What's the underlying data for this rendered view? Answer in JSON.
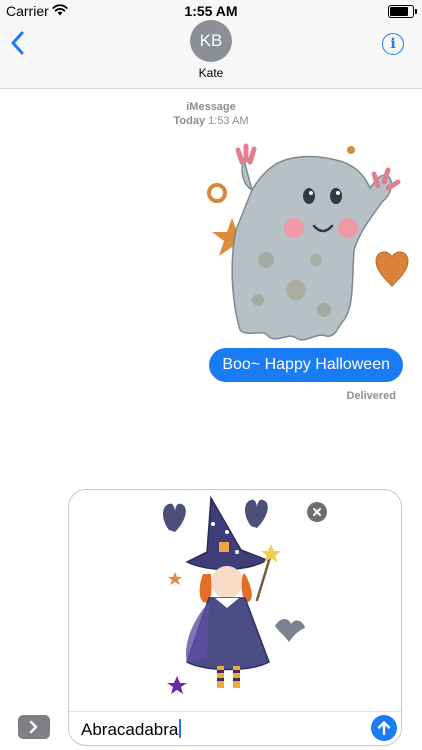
{
  "status_bar": {
    "carrier": "Carrier",
    "time": "1:55 AM",
    "battery_level": 0.9
  },
  "header": {
    "avatar_initials": "KB",
    "contact_name": "Kate",
    "info_glyph": "i"
  },
  "conversation": {
    "service": "iMessage",
    "timestamp_day": "Today",
    "timestamp_time": "1:53 AM",
    "messages": [
      {
        "type": "sticker",
        "sticker": "ghost-sticker",
        "from": "me"
      },
      {
        "type": "text",
        "text": "Boo~ Happy Halloween",
        "from": "me"
      }
    ],
    "delivery_status": "Delivered"
  },
  "composer": {
    "staged_sticker": "witch-sticker",
    "text": "Abracadabra"
  },
  "colors": {
    "accent": "#1a7cf5",
    "avatar": "#8d8f97",
    "header_bg": "#f7f7f7",
    "meta_text": "#8e8e93"
  },
  "icons": [
    "wifi-icon",
    "battery-icon",
    "back-chevron-icon",
    "info-icon",
    "expand-arrow-icon",
    "remove-x-icon",
    "send-arrow-icon"
  ]
}
